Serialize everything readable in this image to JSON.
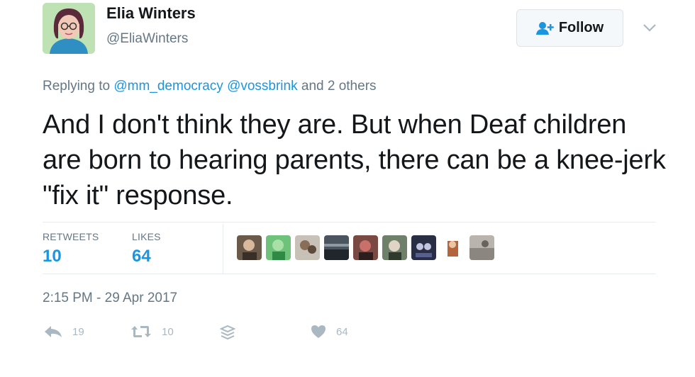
{
  "tweet": {
    "author": {
      "name": "Elia Winters",
      "handle": "@EliaWinters"
    },
    "follow_label": "Follow",
    "replying_prefix": "Replying to",
    "replying_user1": "@mm_democracy",
    "replying_user2": "@vossbrink",
    "replying_suffix": "and 2 others",
    "text": "And I don't think they are. But when Deaf children are born to hearing parents, there can be a knee-jerk \"fix it\" response.",
    "stats": {
      "retweets_label": "RETWEETS",
      "retweets_value": "10",
      "likes_label": "LIKES",
      "likes_value": "64"
    },
    "timestamp": "2:15 PM - 29 Apr 2017",
    "actions": {
      "reply_count": "19",
      "retweet_count": "10",
      "like_count": "64"
    }
  },
  "colors": {
    "link": "#1b95e0",
    "muted": "#657786",
    "icon": "#aab8c2",
    "text": "#14171a"
  },
  "icons": [
    "follow-user-icon",
    "chevron-down-icon",
    "reply-icon",
    "retweet-icon",
    "stack-icon",
    "heart-icon"
  ]
}
